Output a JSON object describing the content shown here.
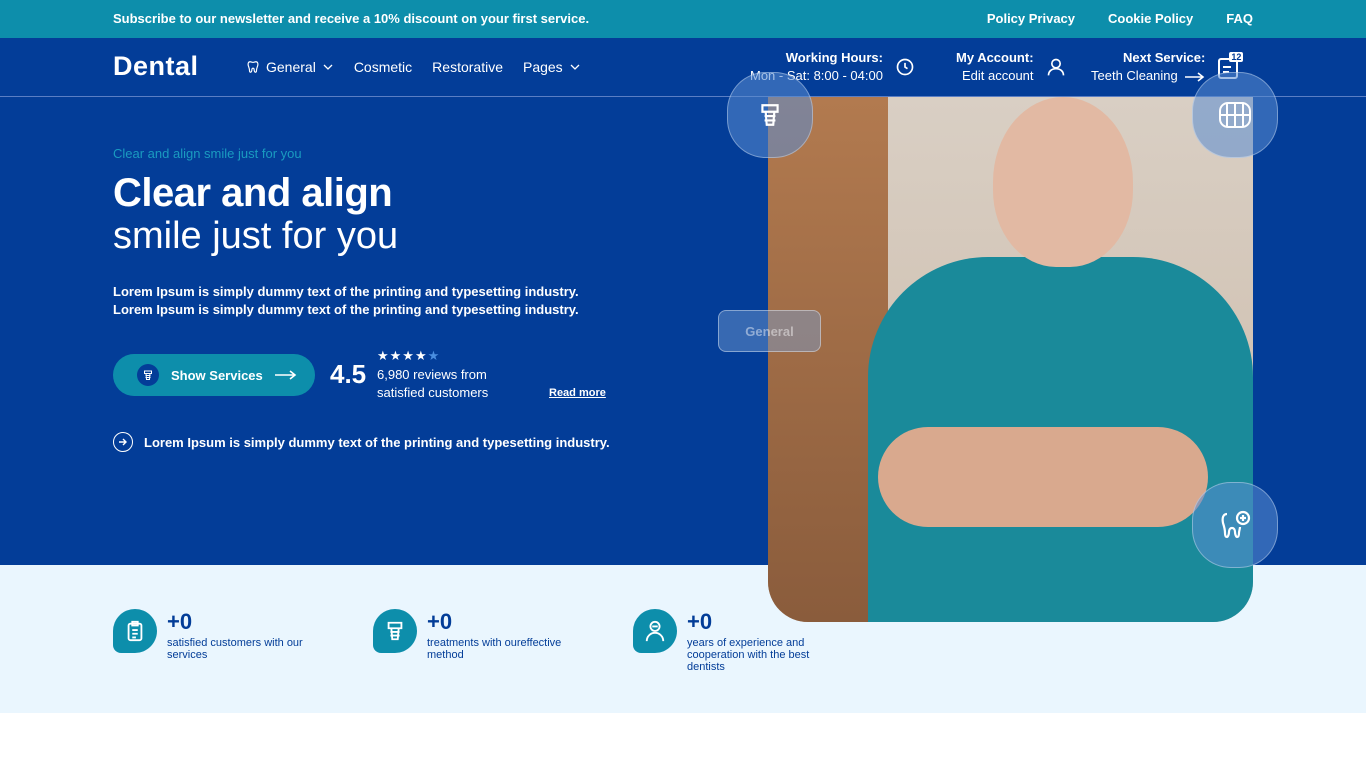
{
  "topbar": {
    "promo": "Subscribe to our newsletter and receive a 10% discount on your first service.",
    "links": [
      "Policy Privacy",
      "Cookie Policy",
      "FAQ"
    ]
  },
  "header": {
    "logo": "Dental",
    "nav": [
      {
        "label": "General",
        "icon": "tooth-icon",
        "dropdown": true
      },
      {
        "label": "Cosmetic",
        "dropdown": false
      },
      {
        "label": "Restorative",
        "dropdown": false
      },
      {
        "label": "Pages",
        "dropdown": true
      }
    ],
    "hours": {
      "title": "Working Hours:",
      "value": "Mon - Sat: 8:00 - 04:00"
    },
    "account": {
      "title": "My Account:",
      "value": "Edit account"
    },
    "next_service": {
      "title": "Next Service:",
      "value": "Teeth Cleaning",
      "badge": "12"
    }
  },
  "hero": {
    "eyebrow": "Clear and align smile just for you",
    "title_line1": "Clear and align",
    "title_line2": "smile just for you",
    "paragraph_line1": "Lorem Ipsum is simply dummy text of the printing and typesetting industry.",
    "paragraph_line2": "Lorem Ipsum is simply dummy text of the printing and typesetting industry.",
    "button": "Show Services",
    "rating": "4.5",
    "stars_filled": 4,
    "stars_total": 5,
    "reviews_line1": "6,980 reviews from",
    "reviews_line2": "satisfied customers",
    "read_more": "Read more",
    "note": "Lorem Ipsum is simply dummy text of the printing and typesetting industry.",
    "glass_button": "General"
  },
  "stats": [
    {
      "number": "+0",
      "label": "satisfied customers with our services"
    },
    {
      "number": "+0",
      "label": "treatments with oureffective method"
    },
    {
      "number": "+0",
      "label": "years of experience and cooperation with the best dentists"
    }
  ],
  "colors": {
    "primary": "#033d98",
    "accent": "#0d8eab",
    "light": "#eaf6fe"
  }
}
